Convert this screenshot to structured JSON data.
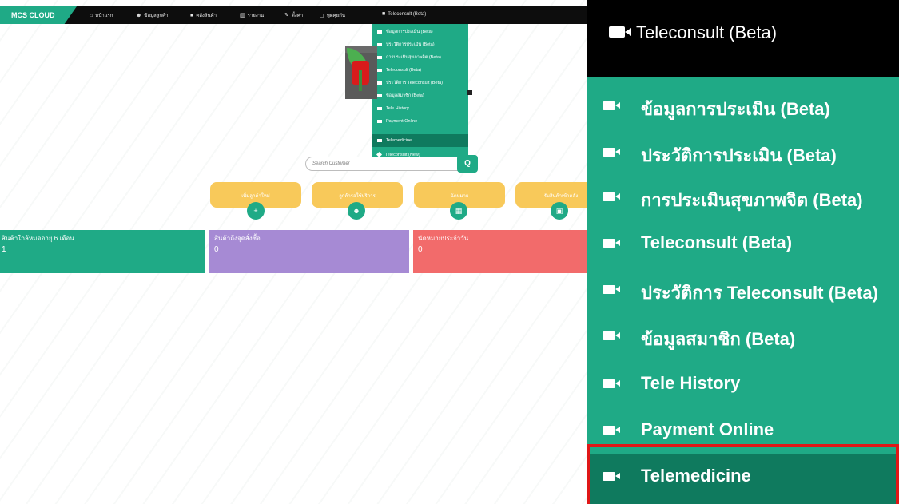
{
  "brand": "MCS CLOUD",
  "nav": [
    {
      "icon": "home-icon",
      "glyph": "⌂",
      "label": "หน้าแรก"
    },
    {
      "icon": "users-icon",
      "glyph": "☻",
      "label": "ข้อมูลลูกค้า"
    },
    {
      "icon": "box-icon",
      "glyph": "■",
      "label": "คลังสินค้า"
    },
    {
      "icon": "chart-icon",
      "glyph": "▥",
      "label": "รายงาน"
    },
    {
      "icon": "wrench-icon",
      "glyph": "✎",
      "label": "ตั้งค่า"
    },
    {
      "icon": "chat-icon",
      "glyph": "◻",
      "label": "พูดคุยกัน"
    },
    {
      "icon": "video-icon",
      "glyph": "■",
      "label": "Teleconsult (Beta)"
    }
  ],
  "menu_items": [
    "ข้อมูลการประเมิน (Beta)",
    "ประวัติการประเมิน (Beta)",
    "การประเมินสุขภาพจิต (Beta)",
    "Teleconsult (Beta)",
    "ประวัติการ Teleconsult (Beta)",
    "ข้อมูลสมาชิก (Beta)",
    "Tele History",
    "Payment Online",
    "Telemedicine"
  ],
  "mini_extra_item": "Teleconsult (New)",
  "selected_menu_item": "Telemedicine",
  "search": {
    "placeholder": "Search Customer"
  },
  "actions": [
    {
      "label": "เพิ่มลูกค้าใหม่",
      "icon": "add-user-icon",
      "glyph": "+"
    },
    {
      "label": "ลูกค้ารอใช้บริการ",
      "icon": "group-icon",
      "glyph": "☻"
    },
    {
      "label": "นัดหมาย",
      "icon": "calendar-icon",
      "glyph": "▦"
    },
    {
      "label": "รับสินค้าเข้าคลัง",
      "icon": "box-icon",
      "glyph": "▣"
    }
  ],
  "stats": [
    {
      "title": "สินค้าใกล้หมดอายุ 6 เดือน",
      "value": "1",
      "color": "#1faa86"
    },
    {
      "title": "สินค้าถึงจุดสั่งซื้อ",
      "value": "0",
      "color": "#a68ad4"
    },
    {
      "title": "นัดหมายประจำวัน",
      "value": "0",
      "color": "#f26b6b"
    }
  ],
  "zoom": {
    "header": "Teleconsult (Beta)"
  },
  "colors": {
    "accent": "#1faa86",
    "active": "#0f7a5e",
    "highlight": "#e01717"
  }
}
